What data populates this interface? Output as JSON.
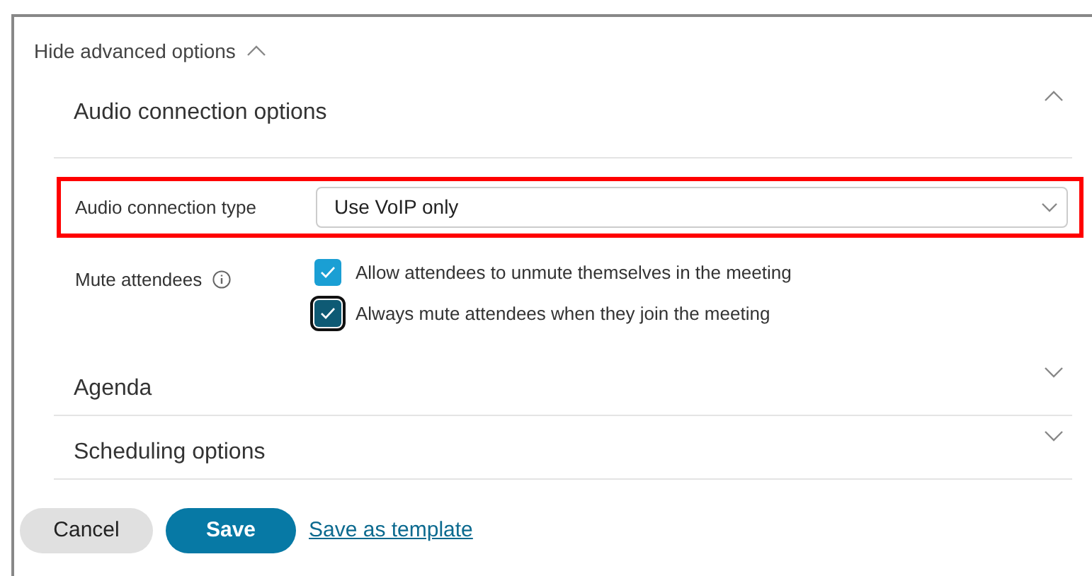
{
  "advanced_toggle": {
    "label": "Hide advanced options",
    "expanded": true
  },
  "sections": [
    {
      "title": "Audio connection options",
      "expanded": true,
      "fields": [
        {
          "kind": "select",
          "label": "Audio connection type",
          "value": "Use VoIP only",
          "highlighted": true
        },
        {
          "kind": "checkboxes",
          "label": "Mute attendees",
          "info": true,
          "options": [
            {
              "label": "Allow attendees to unmute themselves in the meeting",
              "checked": true,
              "focused": false
            },
            {
              "label": "Always mute attendees when they join the meeting",
              "checked": true,
              "focused": true
            }
          ]
        }
      ]
    },
    {
      "title": "Agenda",
      "expanded": false
    },
    {
      "title": "Scheduling options",
      "expanded": false
    }
  ],
  "buttons": [
    {
      "kind": "secondary",
      "label": "Cancel"
    },
    {
      "kind": "primary",
      "label": "Save"
    },
    {
      "kind": "link",
      "label": "Save as template"
    }
  ]
}
